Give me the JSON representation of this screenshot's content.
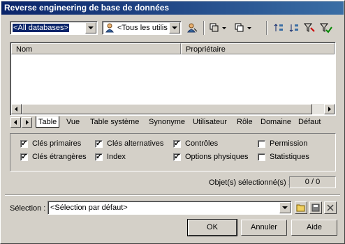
{
  "window": {
    "title": "Reverse engineering de base de données"
  },
  "toolbar": {
    "database_combo": "<All databases>",
    "owner_combo": "<Tous les utilisa"
  },
  "list": {
    "columns": [
      "Nom",
      "Propriétaire"
    ]
  },
  "tabs": [
    "Table",
    "Vue",
    "Table système",
    "Synonyme",
    "Utilisateur",
    "Rôle",
    "Domaine",
    "Défaut"
  ],
  "options": {
    "cles_primaires": "Clés primaires",
    "cles_etrangeres": "Clés étrangères",
    "cles_alternatives": "Clés alternatives",
    "index": "Index",
    "controles": "Contrôles",
    "options_physiques": "Options physiques",
    "permission": "Permission",
    "statistiques": "Statistiques"
  },
  "selected_count": {
    "label": "Objet(s) sélectionné(s) :",
    "value": "0 / 0"
  },
  "selection": {
    "label": "Sélection :",
    "value": "<Sélection par défaut>"
  },
  "buttons": {
    "ok": "OK",
    "cancel": "Annuler",
    "help": "Aide"
  }
}
